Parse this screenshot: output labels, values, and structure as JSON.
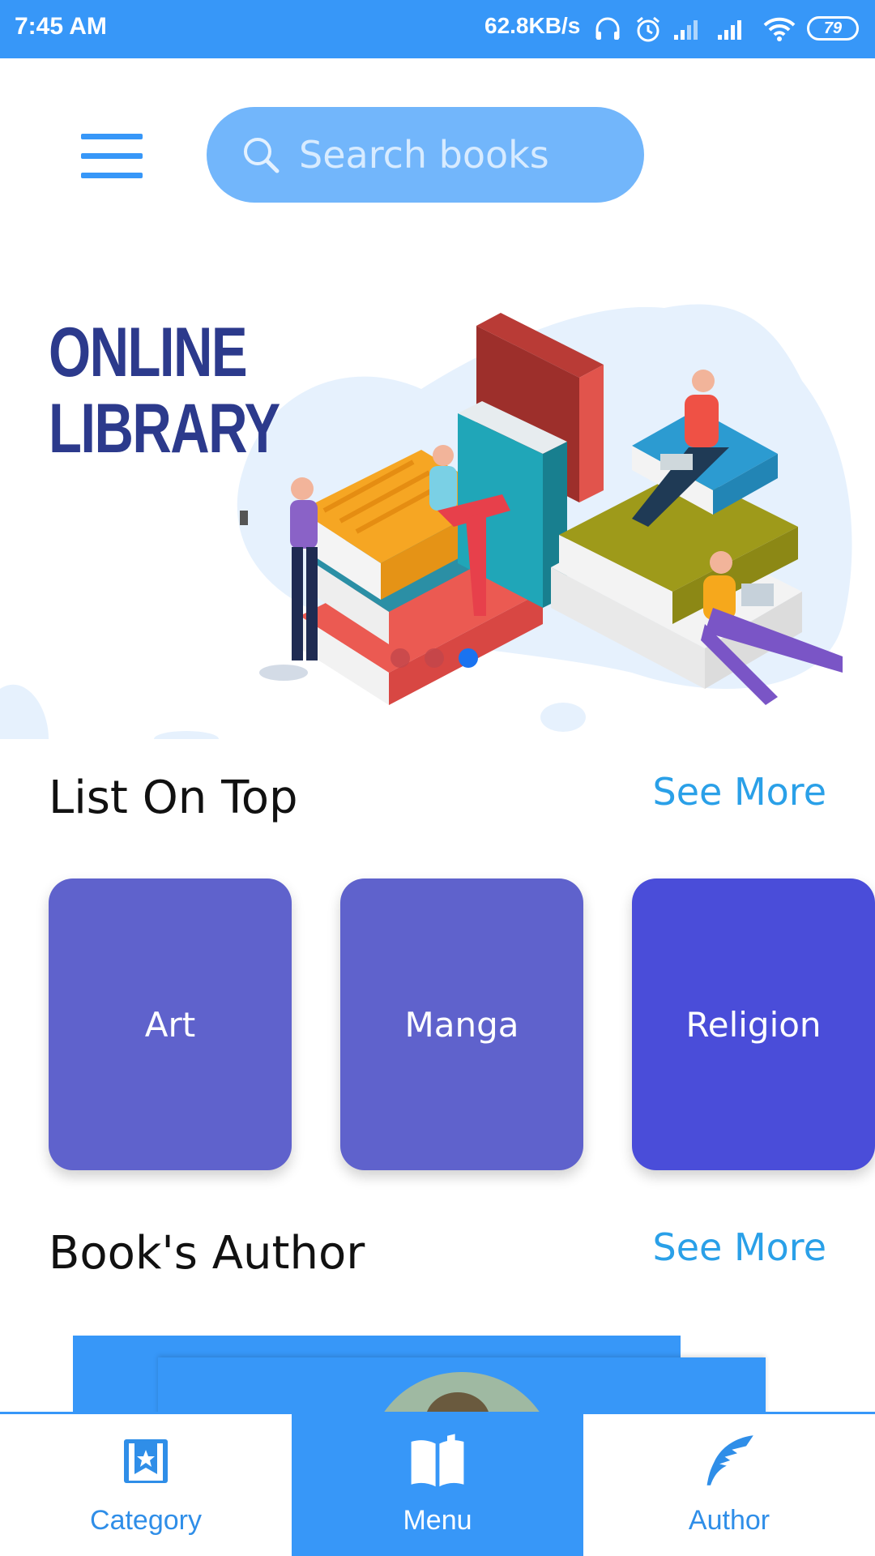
{
  "status_bar": {
    "time": "7:45 AM",
    "net_speed": "62.8KB/s",
    "battery": "79",
    "icons": [
      "headphones-icon",
      "alarm-icon",
      "signal-icon",
      "signal-icon",
      "wifi-icon",
      "battery-icon"
    ]
  },
  "header": {
    "menu_icon": "hamburger-menu-icon",
    "search_placeholder": "Search books",
    "search_icon": "search-icon"
  },
  "hero": {
    "title_line1": "ONLINE",
    "title_line2": "LIBRARY",
    "carousel_active_index": 2,
    "carousel_count": 3
  },
  "list_on_top": {
    "title": "List On Top",
    "see_more": "See More",
    "cards": [
      {
        "label": "Art",
        "color": "#5f62cc"
      },
      {
        "label": "Manga",
        "color": "#5f62cc"
      },
      {
        "label": "Religion",
        "color": "#4a4dd9"
      }
    ]
  },
  "books_author": {
    "title": "Book's Author",
    "see_more": "See More"
  },
  "bottom_nav": {
    "items": [
      {
        "label": "Category",
        "icon": "bookmark-star-icon",
        "active": false
      },
      {
        "label": "Menu",
        "icon": "open-book-icon",
        "active": true
      },
      {
        "label": "Author",
        "icon": "feather-quill-icon",
        "active": false
      }
    ]
  },
  "colors": {
    "primary": "#3797f8",
    "title_navy": "#2c3a8c",
    "link": "#2aa0e8"
  }
}
